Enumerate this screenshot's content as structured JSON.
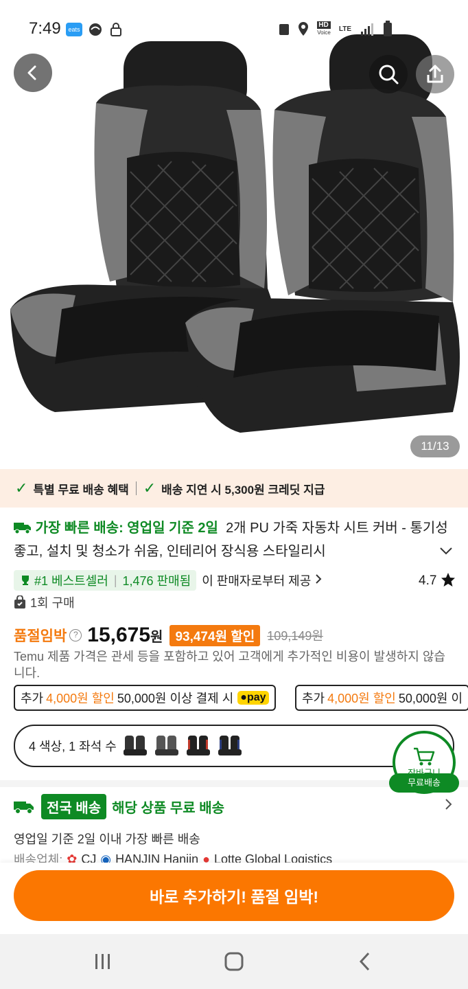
{
  "status_bar": {
    "time": "7:49",
    "eats_label": "eats",
    "network": "LTE",
    "hd_label": "HD",
    "voice_label": "Voice"
  },
  "gallery": {
    "counter": "11/13"
  },
  "benefits": {
    "item1": "특별 무료 배송 혜택",
    "item2": "배송 지연 시 5,300원 크레딧 지급"
  },
  "product": {
    "fast_shipping": "가장 빠른 배송: 영업일 기준 2일",
    "title": "2개 PU 가죽 자동차 시트 커버 - 통기성 좋고, 설치 및 청소가 쉬움, 인테리어 장식용 스타일리시",
    "bestseller": "#1 베스트셀러",
    "sold_count": "1,476 판매됨",
    "seller_link": "이 판매자로부터 제공",
    "rating": "4.7",
    "purchase_count": "1회 구매",
    "soldout_label": "품절임박",
    "price": "15,675",
    "price_unit": "원",
    "discount": "93,474원 할인",
    "original_price": "109,149원",
    "tax_note": "Temu 제품 가격은 관세 등을 포함하고 있어 고객에게 추가적인 비용이 발생하지 않습니다."
  },
  "promos": [
    {
      "prefix": "추가",
      "amount": "4,000원 할인",
      "condition": "50,000원 이상 결제 시",
      "pay": "pay"
    },
    {
      "prefix": "추가",
      "amount": "4,000원 할인",
      "condition": "50,000원 이"
    }
  ],
  "options": {
    "label": "4 색상, 1 좌석 수",
    "thumb_colors": [
      "#333333",
      "#555555",
      "#c0392b",
      "#2c3e80"
    ]
  },
  "cart": {
    "label": "장바구니",
    "free_shipping": "무료배송"
  },
  "shipping": {
    "badge": "전국 배송",
    "headline": "해당 상품 무료 배송",
    "sub": "영업일 기준 2일 이내 가장 빠른 배송",
    "carrier_label": "배송업체:",
    "carriers": [
      "CJ",
      "HANJIN Hanjin",
      "Lotte Global Logistics"
    ]
  },
  "cta": {
    "label": "바로 추가하기! 품절 임박!"
  },
  "colors": {
    "accent_orange": "#fb7701",
    "accent_green": "#0e8a24",
    "banner_bg": "#fdeee3"
  }
}
